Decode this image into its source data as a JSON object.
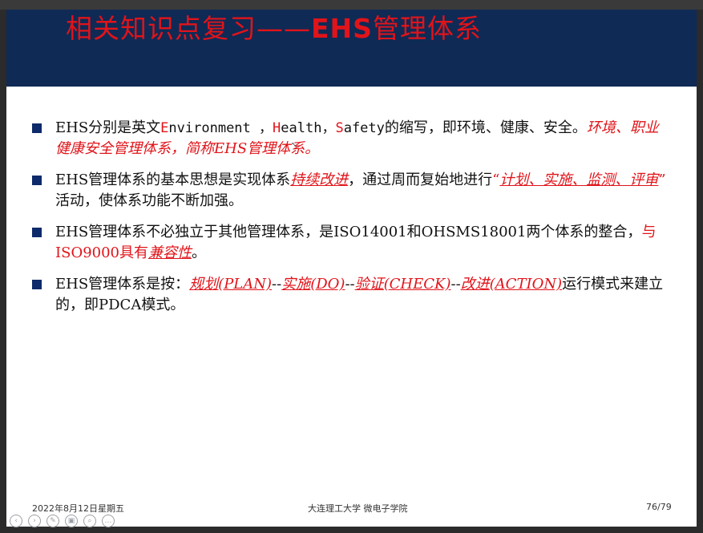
{
  "slide": {
    "title_prefix": "相关知识点复习——",
    "title_ehs": "EHS",
    "title_suffix": "管理体系",
    "bullets": [
      {
        "parts": [
          {
            "text": "EHS分别是英文",
            "style": ""
          },
          {
            "text": "E",
            "style": "red mono"
          },
          {
            "text": "nvironment ，",
            "style": "mono"
          },
          {
            "text": "H",
            "style": "red mono"
          },
          {
            "text": "ealth，",
            "style": "mono"
          },
          {
            "text": "S",
            "style": "red mono"
          },
          {
            "text": "afety",
            "style": "mono"
          },
          {
            "text": "的缩写，即环境、健康、安全。",
            "style": ""
          },
          {
            "text": "环境、职业健康安全管理体系，简称EHS管理体系。",
            "style": "red it"
          }
        ]
      },
      {
        "parts": [
          {
            "text": "EHS管理体系的基本思想是实现体系",
            "style": ""
          },
          {
            "text": "持续改进",
            "style": "red it u"
          },
          {
            "text": "，通过周而复始地进行",
            "style": ""
          },
          {
            "text": "“",
            "style": "red"
          },
          {
            "text": "计划、实施、监测、评审",
            "style": "red it u"
          },
          {
            "text": "”",
            "style": "red"
          },
          {
            "text": "  活动，使体系功能不断加强。",
            "style": ""
          }
        ]
      },
      {
        "parts": [
          {
            "text": "EHS管理体系不必独立于其他管理体系，是ISO14001和OHSMS18001两个体系的整合，",
            "style": ""
          },
          {
            "text": "与ISO9000具有",
            "style": "red"
          },
          {
            "text": "兼容性",
            "style": "red it u"
          },
          {
            "text": "。",
            "style": ""
          }
        ]
      },
      {
        "parts": [
          {
            "text": "EHS管理体系是按：",
            "style": ""
          },
          {
            "text": "规划(PLAN)",
            "style": "red it u"
          },
          {
            "text": "--",
            "style": ""
          },
          {
            "text": "实施(DO)",
            "style": "red it u"
          },
          {
            "text": "--",
            "style": ""
          },
          {
            "text": "验证(CHECK)",
            "style": "red it u"
          },
          {
            "text": "--",
            "style": ""
          },
          {
            "text": "改进(ACTION)",
            "style": "red it u"
          },
          {
            "text": "运行模式来建立的，即PDCA模式。",
            "style": ""
          }
        ]
      }
    ],
    "footer_date": "2022年8月12日星期五",
    "footer_org": "大连理工大学  微电子学院",
    "footer_page": "76/79"
  },
  "controls": [
    {
      "name": "prev-icon",
      "glyph": "‹"
    },
    {
      "name": "next-icon",
      "glyph": "›"
    },
    {
      "name": "pen-icon",
      "glyph": "✎"
    },
    {
      "name": "slides-icon",
      "glyph": "▣"
    },
    {
      "name": "zoom-icon",
      "glyph": "⌕"
    },
    {
      "name": "more-icon",
      "glyph": "…"
    }
  ],
  "colors": {
    "title_band": "#0f2a55",
    "title_text": "#e0141a",
    "bullet_square": "#0d2a6a",
    "emphasis_red": "#e0141a"
  }
}
